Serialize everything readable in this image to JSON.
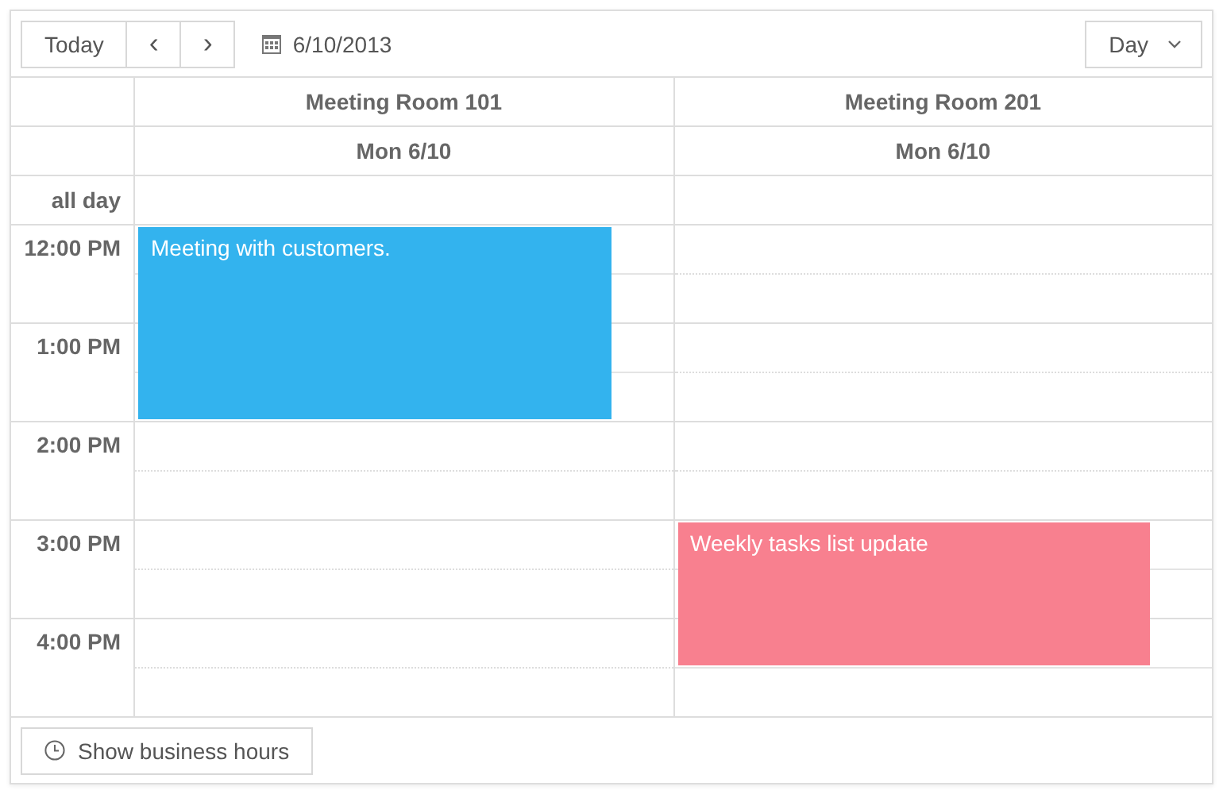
{
  "toolbar": {
    "today": "Today",
    "prev": "‹",
    "next": "›",
    "date": "6/10/2013",
    "view": "Day"
  },
  "rooms": [
    {
      "name": "Meeting Room 101",
      "date": "Mon 6/10",
      "events": [
        {
          "title": "Meeting with customers.",
          "color": "#33b3ee"
        }
      ],
      "slots": [
        {
          "booked": true
        },
        {
          "booked": true
        },
        {
          "booked": true
        },
        {
          "booked": true
        },
        {
          "booked": false
        },
        {
          "booked": false
        },
        {
          "booked": false
        },
        {
          "booked": false
        },
        {
          "booked": false
        },
        {
          "booked": false
        }
      ]
    },
    {
      "name": "Meeting Room 201",
      "date": "Mon 6/10",
      "events": [
        {
          "title": "Weekly tasks list update",
          "color": "#f8808f"
        }
      ],
      "slots": [
        {
          "booked": false
        },
        {
          "booked": false
        },
        {
          "booked": false
        },
        {
          "booked": false
        },
        {
          "booked": false
        },
        {
          "booked": false
        },
        {
          "booked": true
        },
        {
          "booked": true
        },
        {
          "booked": true
        },
        {
          "booked": false
        }
      ]
    }
  ],
  "all_day_label": "all day",
  "times": [
    "12:00 PM",
    "1:00 PM",
    "2:00 PM",
    "3:00 PM",
    "4:00 PM"
  ],
  "footer": {
    "button": "Show business hours"
  }
}
